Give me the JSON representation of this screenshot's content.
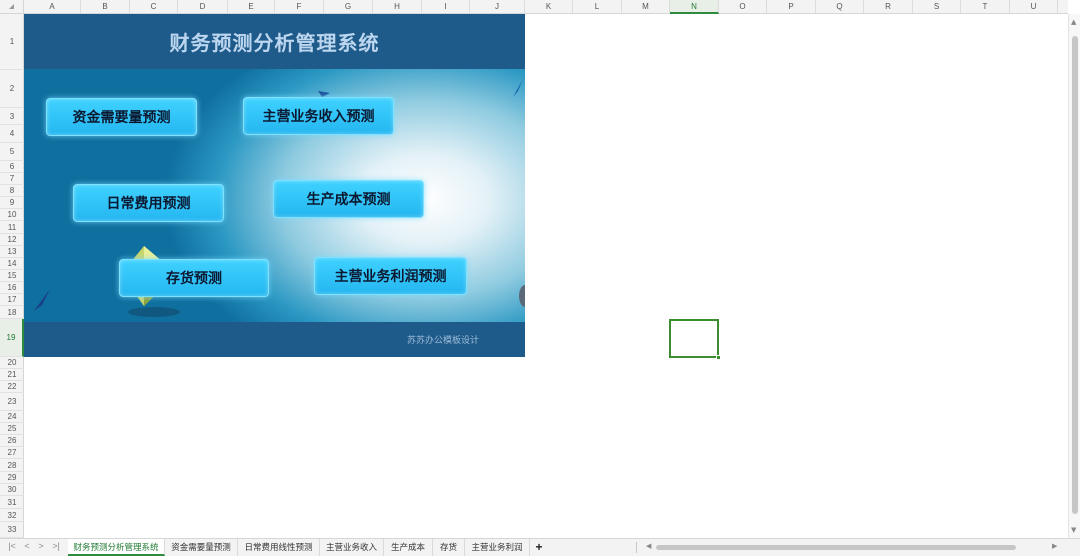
{
  "columns": [
    "A",
    "B",
    "C",
    "D",
    "E",
    "F",
    "G",
    "H",
    "I",
    "J",
    "K",
    "L",
    "M",
    "N",
    "O",
    "P",
    "Q",
    "R",
    "S",
    "T",
    "U"
  ],
  "rows": [
    "1",
    "2",
    "3",
    "4",
    "5",
    "6",
    "7",
    "8",
    "9",
    "10",
    "11",
    "12",
    "13",
    "14",
    "15",
    "16",
    "17",
    "18",
    "19",
    "20",
    "21",
    "22",
    "23",
    "24",
    "25",
    "26",
    "27",
    "28",
    "29",
    "30",
    "31",
    "32",
    "33"
  ],
  "active_column": "N",
  "active_row": "19",
  "dashboard": {
    "title": "财务预测分析管理系统",
    "footer": "苏苏办公模板设计",
    "buttons": [
      {
        "label": "资金需要量预测"
      },
      {
        "label": "主营业务收入预测"
      },
      {
        "label": "日常费用预测"
      },
      {
        "label": "生产成本预测"
      },
      {
        "label": "存货预测"
      },
      {
        "label": "主营业务利润预测"
      }
    ]
  },
  "sheet_tabs": [
    {
      "label": "财务预测分析管理系统",
      "active": true
    },
    {
      "label": "资金需要量预测"
    },
    {
      "label": "日常费用线性预测"
    },
    {
      "label": "主营业务收入"
    },
    {
      "label": "生产成本"
    },
    {
      "label": "存货"
    },
    {
      "label": "主营业务利润"
    }
  ],
  "nav": {
    "first": "|<",
    "prev": "<",
    "next": ">",
    "last": ">|",
    "add": "+"
  },
  "colors": {
    "accent": "#2e8b3d",
    "banner": "#1f5b8a",
    "button": "#2fc4f8"
  }
}
